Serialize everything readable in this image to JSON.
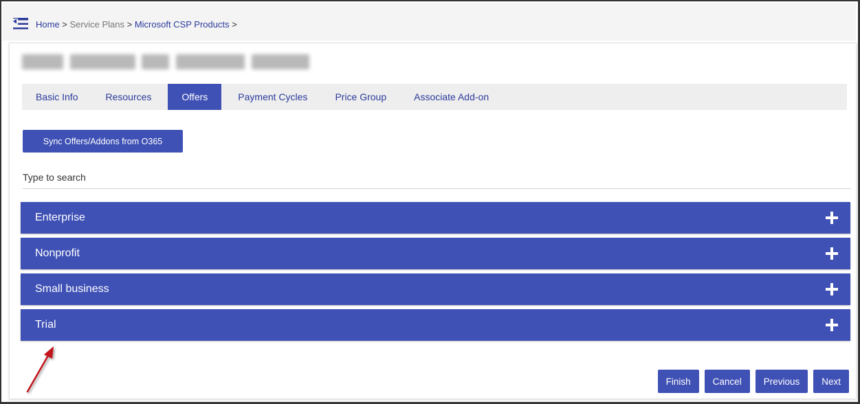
{
  "breadcrumb": {
    "home": "Home",
    "sep1": " > ",
    "service_plans": "Service Plans",
    "sep2": " > ",
    "microsoft_csp": "Microsoft CSP Products",
    "sep3": " >"
  },
  "tabs": [
    {
      "label": "Basic Info"
    },
    {
      "label": "Resources"
    },
    {
      "label": "Offers",
      "active": true
    },
    {
      "label": "Payment Cycles"
    },
    {
      "label": "Price Group"
    },
    {
      "label": "Associate Add-on"
    }
  ],
  "sync_button": {
    "label": "Sync Offers/Addons from O365"
  },
  "search": {
    "placeholder": "Type to search",
    "value": ""
  },
  "accordion": [
    {
      "label": "Enterprise"
    },
    {
      "label": "Nonprofit"
    },
    {
      "label": "Small business"
    },
    {
      "label": "Trial"
    }
  ],
  "actions": {
    "finish": "Finish",
    "cancel": "Cancel",
    "previous": "Previous",
    "next": "Next"
  },
  "colors": {
    "accent": "#3f51b5",
    "link": "#2b3a9b",
    "annotation_arrow": "#c0141a"
  },
  "icons": {
    "menu": "menu-collapse-icon",
    "expand": "plus-icon",
    "annotation": "red-arrow"
  }
}
